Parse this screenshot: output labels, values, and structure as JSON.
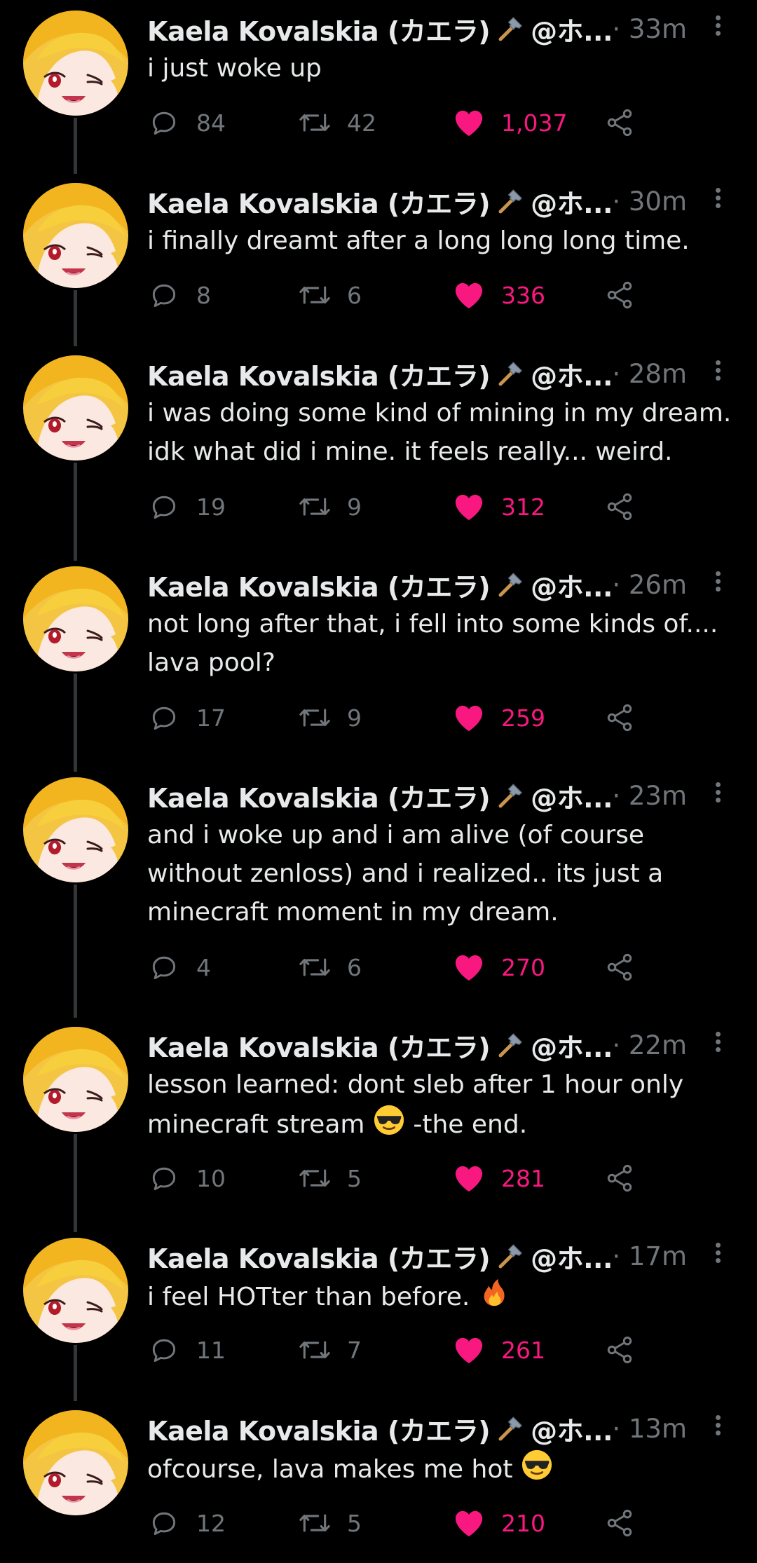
{
  "colors": {
    "background": "#000000",
    "text": "#e7e9ea",
    "muted": "#71767b",
    "like": "#f91880",
    "thread_line": "#333639"
  },
  "icons": {
    "reply": "reply-icon",
    "retweet": "retweet-icon",
    "like": "heart-icon",
    "share": "share-icon",
    "more": "more-icon",
    "hammer": "hammer-emoji"
  },
  "tweets": [
    {
      "name": "Kaela Kovalskia (カエラ)",
      "handle": "@ホ...",
      "time": "· 33m",
      "lines": [
        "i just woke up"
      ],
      "replies": "84",
      "retweets": "42",
      "likes": "1,037"
    },
    {
      "name": "Kaela Kovalskia (カエラ)",
      "handle": "@ホ...",
      "time": "· 30m",
      "lines": [
        "i finally dreamt after a long long long time."
      ],
      "replies": "8",
      "retweets": "6",
      "likes": "336"
    },
    {
      "name": "Kaela Kovalskia (カエラ)",
      "handle": "@ホ...",
      "time": "· 28m",
      "lines": [
        "i was doing some kind of mining in my dream.",
        "idk what did i mine. it feels really... weird."
      ],
      "replies": "19",
      "retweets": "9",
      "likes": "312"
    },
    {
      "name": "Kaela Kovalskia (カエラ)",
      "handle": "@ホ...",
      "time": "· 26m",
      "lines": [
        "not long after that, i fell into some kinds of....",
        "lava pool?"
      ],
      "replies": "17",
      "retweets": "9",
      "likes": "259"
    },
    {
      "name": "Kaela Kovalskia (カエラ)",
      "handle": "@ホ...",
      "time": "· 23m",
      "lines": [
        "and i woke up and i am alive (of course",
        "without zenloss) and i realized.. its just a",
        "minecraft moment in my dream."
      ],
      "replies": "4",
      "retweets": "6",
      "likes": "270"
    },
    {
      "name": "Kaela Kovalskia (カエラ)",
      "handle": "@ホ...",
      "time": "· 22m",
      "lines": [
        "lesson learned: dont sleb after 1 hour only",
        "minecraft stream"
      ],
      "line2_suffix": "-the end.",
      "replies": "10",
      "retweets": "5",
      "likes": "281"
    },
    {
      "name": "Kaela Kovalskia (カエラ)",
      "handle": "@ホ...",
      "time": "· 17m",
      "lines": [
        "i feel HOTter than before."
      ],
      "replies": "11",
      "retweets": "7",
      "likes": "261"
    },
    {
      "name": "Kaela Kovalskia (カエラ)",
      "handle": "@ホ...",
      "time": "· 13m",
      "lines": [
        "ofcourse, lava makes me hot"
      ],
      "replies": "12",
      "retweets": "5",
      "likes": "210"
    }
  ]
}
